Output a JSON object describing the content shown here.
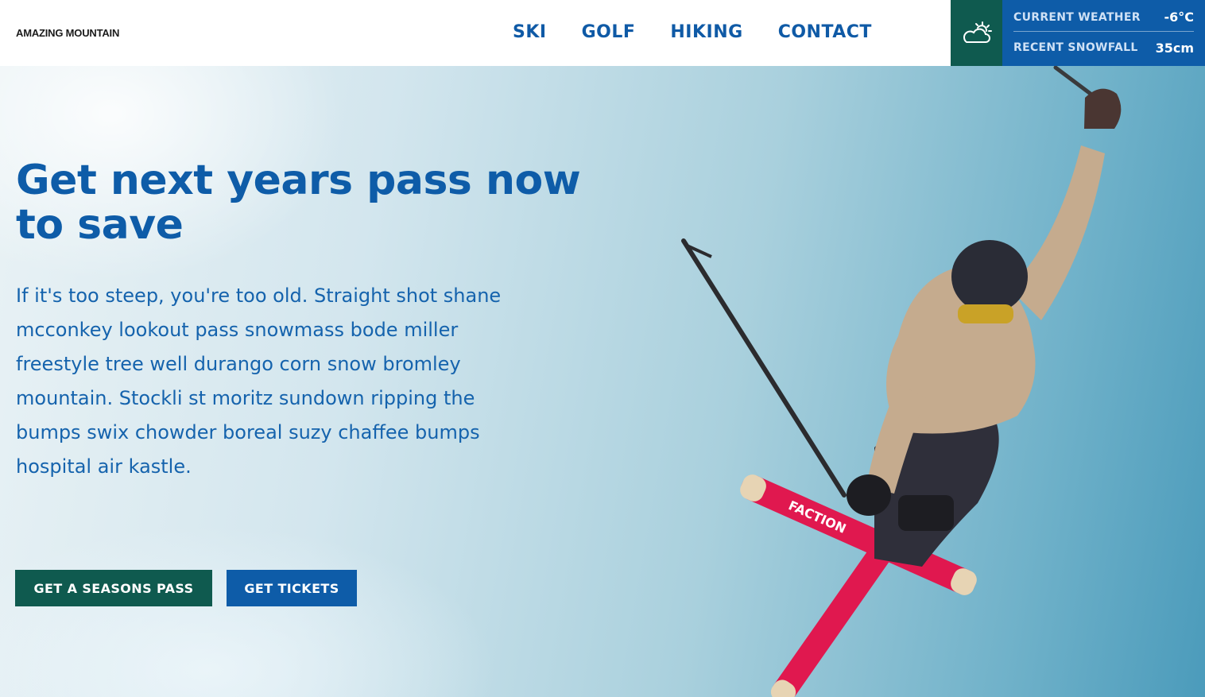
{
  "header": {
    "logo": "AMAZING MOUNTAIN",
    "nav": [
      "SKI",
      "GOLF",
      "HIKING",
      "CONTACT"
    ],
    "weather_icon": "partly-cloudy-icon",
    "weather": {
      "current_label": "CURRENT WEATHER",
      "current_value": "-6°C",
      "snow_label": "RECENT SNOWFALL",
      "snow_value": "35cm"
    }
  },
  "hero": {
    "headline": "Get next years pass now to save",
    "body": "If it's too steep, you're too old. Straight shot shane mcconkey lookout pass snowmass bode miller freestyle tree well durango corn snow bromley mountain. Stockli st moritz sundown ripping the bumps swix chowder boreal suzy chaffee bumps hospital air kastle.",
    "buttons": {
      "pass": "GET A SEASONS PASS",
      "tickets": "GET TICKETS"
    },
    "ski_brand": "FACTION"
  },
  "colors": {
    "primary_blue": "#0e5ca8",
    "dark_green": "#0f5a4f",
    "ski_red": "#e0184f"
  }
}
